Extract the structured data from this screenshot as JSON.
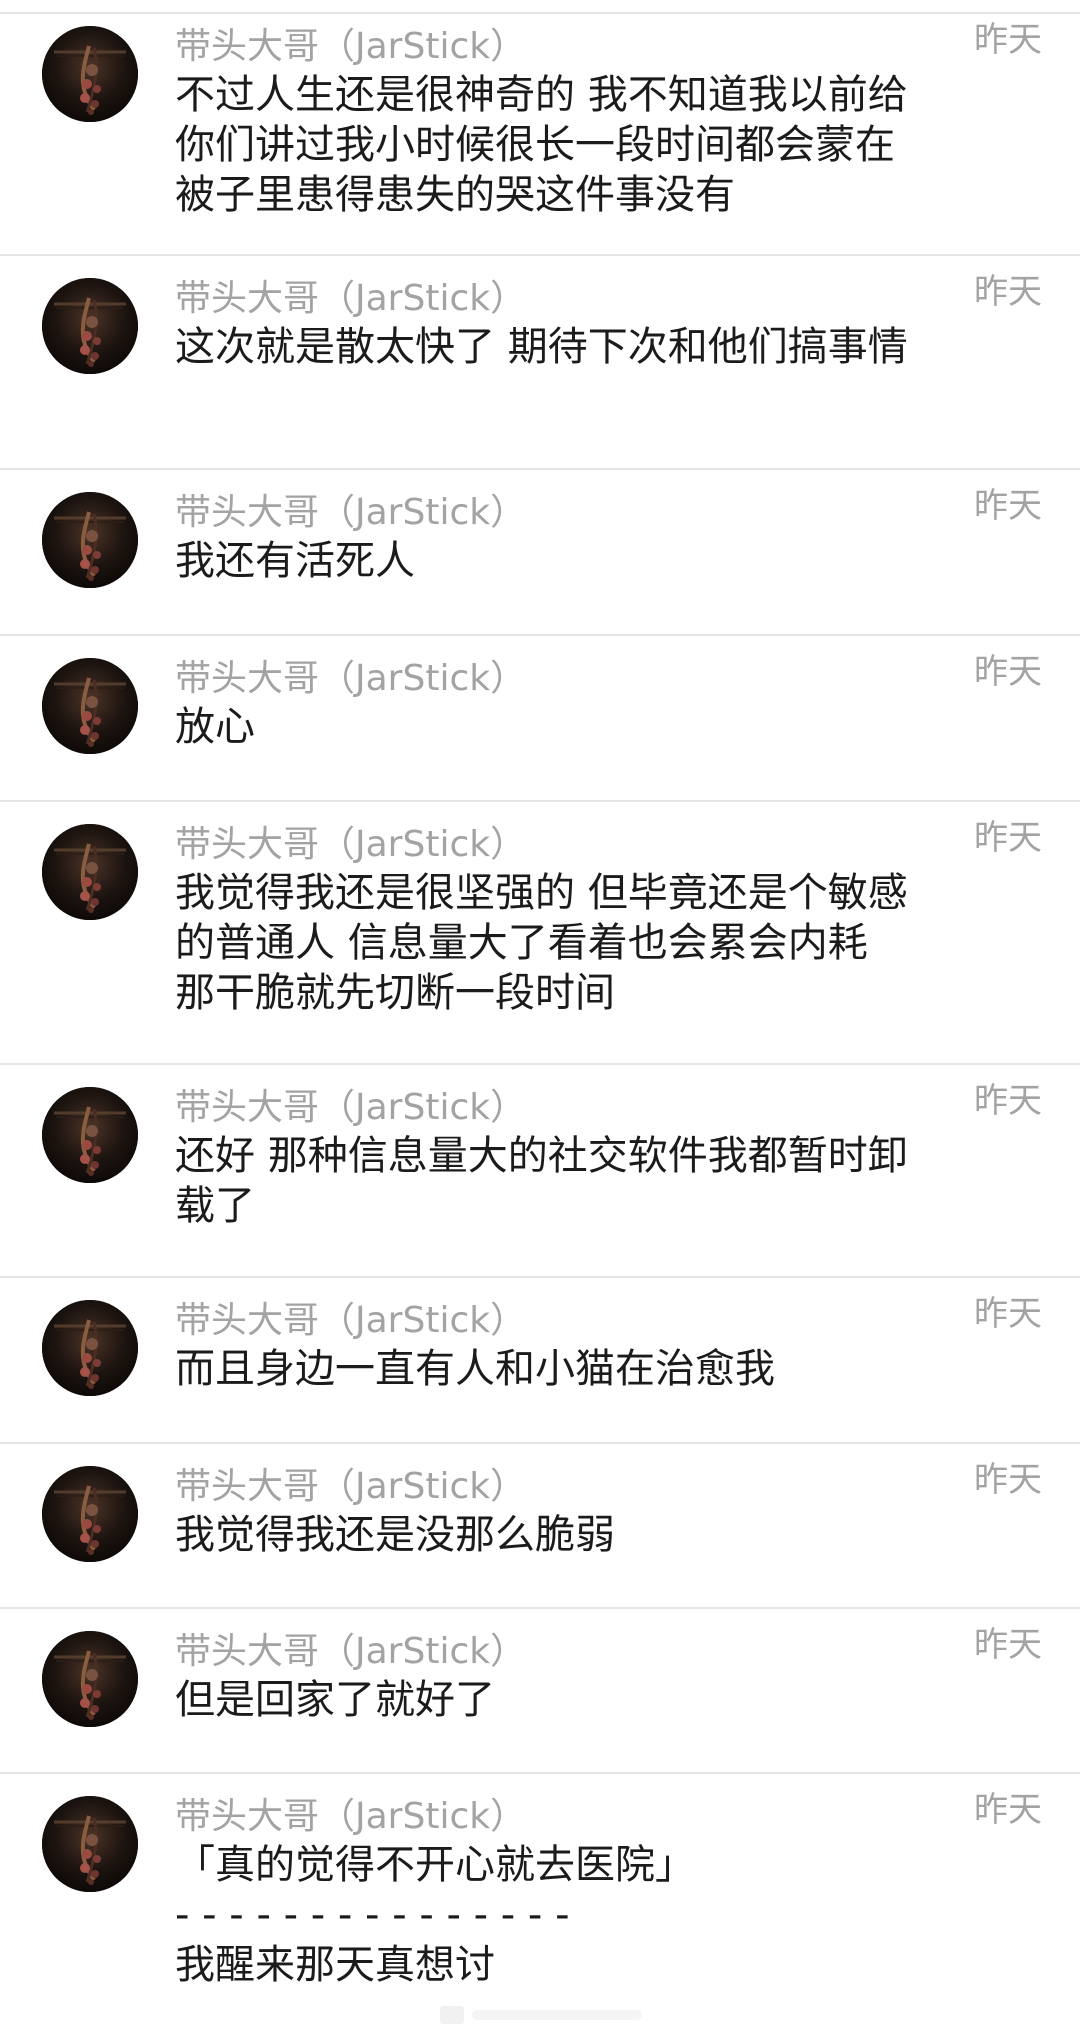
{
  "messages": [
    {
      "sender": "带头大哥（JarStick）",
      "time": "昨天",
      "text": "不过人生还是很神奇的 我不知道我以前给你们讲过我小时候很长一段时间都会蒙在被子里患得患失的哭这件事没有"
    },
    {
      "sender": "带头大哥（JarStick）",
      "time": "昨天",
      "text": "这次就是散太快了 期待下次和他们搞事情"
    },
    {
      "sender": "带头大哥（JarStick）",
      "time": "昨天",
      "text": "我还有活死人"
    },
    {
      "sender": "带头大哥（JarStick）",
      "time": "昨天",
      "text": "放心"
    },
    {
      "sender": "带头大哥（JarStick）",
      "time": "昨天",
      "text": "我觉得我还是很坚强的 但毕竟还是个敏感的普通人 信息量大了看着也会累会内耗 那干脆就先切断一段时间"
    },
    {
      "sender": "带头大哥（JarStick）",
      "time": "昨天",
      "text": "还好 那种信息量大的社交软件我都暂时卸载了"
    },
    {
      "sender": "带头大哥（JarStick）",
      "time": "昨天",
      "text": "而且身边一直有人和小猫在治愈我"
    },
    {
      "sender": "带头大哥（JarStick）",
      "time": "昨天",
      "text": "我觉得我还是没那么脆弱"
    },
    {
      "sender": "带头大哥（JarStick）",
      "time": "昨天",
      "text": "但是回家了就好了"
    },
    {
      "sender": "带头大哥（JarStick）",
      "time": "昨天",
      "text": "「真的觉得不开心就去医院」\n- - - - - - - - - - - - - - -\n我醒来那天真想讨"
    }
  ]
}
